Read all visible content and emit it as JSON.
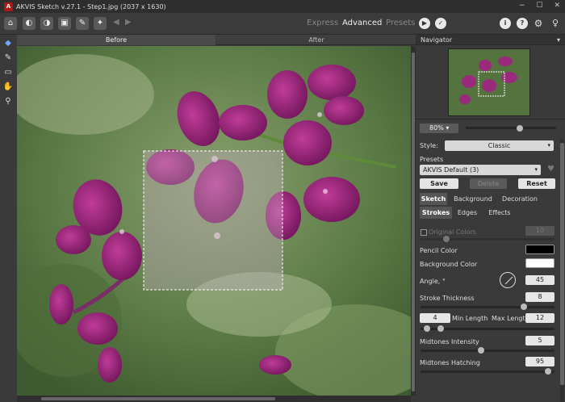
{
  "window": {
    "title": "AKVIS Sketch v.27.1 - Step1.jpg (2037 x 1630)",
    "controls": [
      "−",
      "☐",
      "✕"
    ]
  },
  "toolbar": {
    "modes": [
      "Express",
      "Advanced",
      "Presets"
    ],
    "active_mode": "Advanced",
    "undo_icon": "undo-arrow-icon",
    "redo_icon": "redo-arrow-icon"
  },
  "view_tabs": [
    "Before",
    "After"
  ],
  "navigator": {
    "title": "Navigator",
    "zoom": "80%",
    "zoom_level": 0.6
  },
  "settings": {
    "style_label": "Style:",
    "style_value": "Classic",
    "presets_label": "Presets",
    "preset_value": "AKVIS Default (3)",
    "save": "Save",
    "delete": "Delete",
    "reset": "Reset",
    "main_tabs": [
      "Sketch",
      "Background",
      "Decoration"
    ],
    "sub_tabs": [
      "Strokes",
      "Edges",
      "Effects"
    ],
    "original_colors_label": "Original Colors",
    "original_colors_value": "10",
    "pencil_color_label": "Pencil Color",
    "pencil_color": "#000000",
    "background_color_label": "Background Color",
    "background_color": "#ffffff",
    "angle_label": "Angle, °",
    "angle_value": "45",
    "stroke_thickness_label": "Stroke Thickness",
    "stroke_thickness_value": "8",
    "min_length_value": "4",
    "min_length_label": "Min Length",
    "max_length_label": "Max Length",
    "max_length_value": "12",
    "midtones_intensity_label": "Midtones Intensity",
    "midtones_intensity_value": "5",
    "midtones_hatching_label": "Midtones Hatching",
    "midtones_hatching_value": "95"
  },
  "colors": {
    "accent": "#b01818",
    "panel_bg": "#3a3a3a"
  }
}
